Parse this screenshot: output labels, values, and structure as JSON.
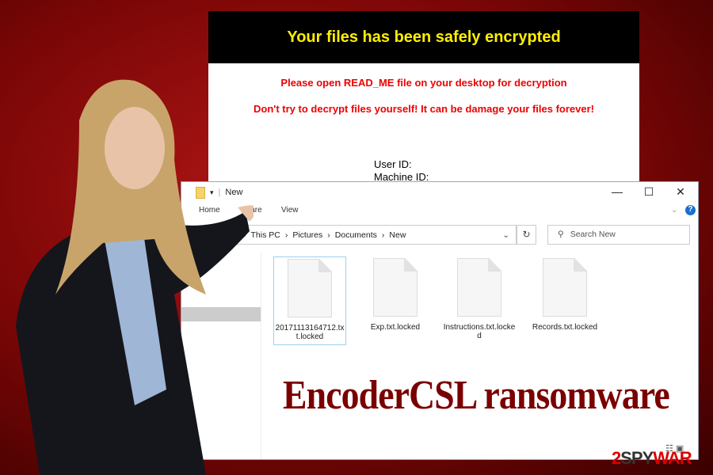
{
  "ransom_note": {
    "title": "Your files has been safely encrypted",
    "line1": "Please open READ_ME file on your desktop for decryption",
    "line2": "Don't try to decrypt files yourself! It can be damage your files forever!",
    "user_id_label": "User ID:",
    "machine_id_label": "Machine ID:"
  },
  "explorer": {
    "window_title": "New",
    "ribbon_tabs": [
      "Home",
      "Share",
      "View"
    ],
    "breadcrumb": [
      "This PC",
      "Pictures",
      "Documents",
      "New"
    ],
    "search_placeholder": "Search New",
    "files": [
      {
        "name": "20171113164712.txt.locked"
      },
      {
        "name": "Exp.txt.locked"
      },
      {
        "name": "Instructions.txt.locked"
      },
      {
        "name": "Records.txt.locked"
      }
    ]
  },
  "headline": "EncoderCSL ransomware",
  "watermark": "2SPYWAR",
  "colors": {
    "accent": "#e00000",
    "note_title": "#ffef00",
    "headline": "#7a0000"
  }
}
